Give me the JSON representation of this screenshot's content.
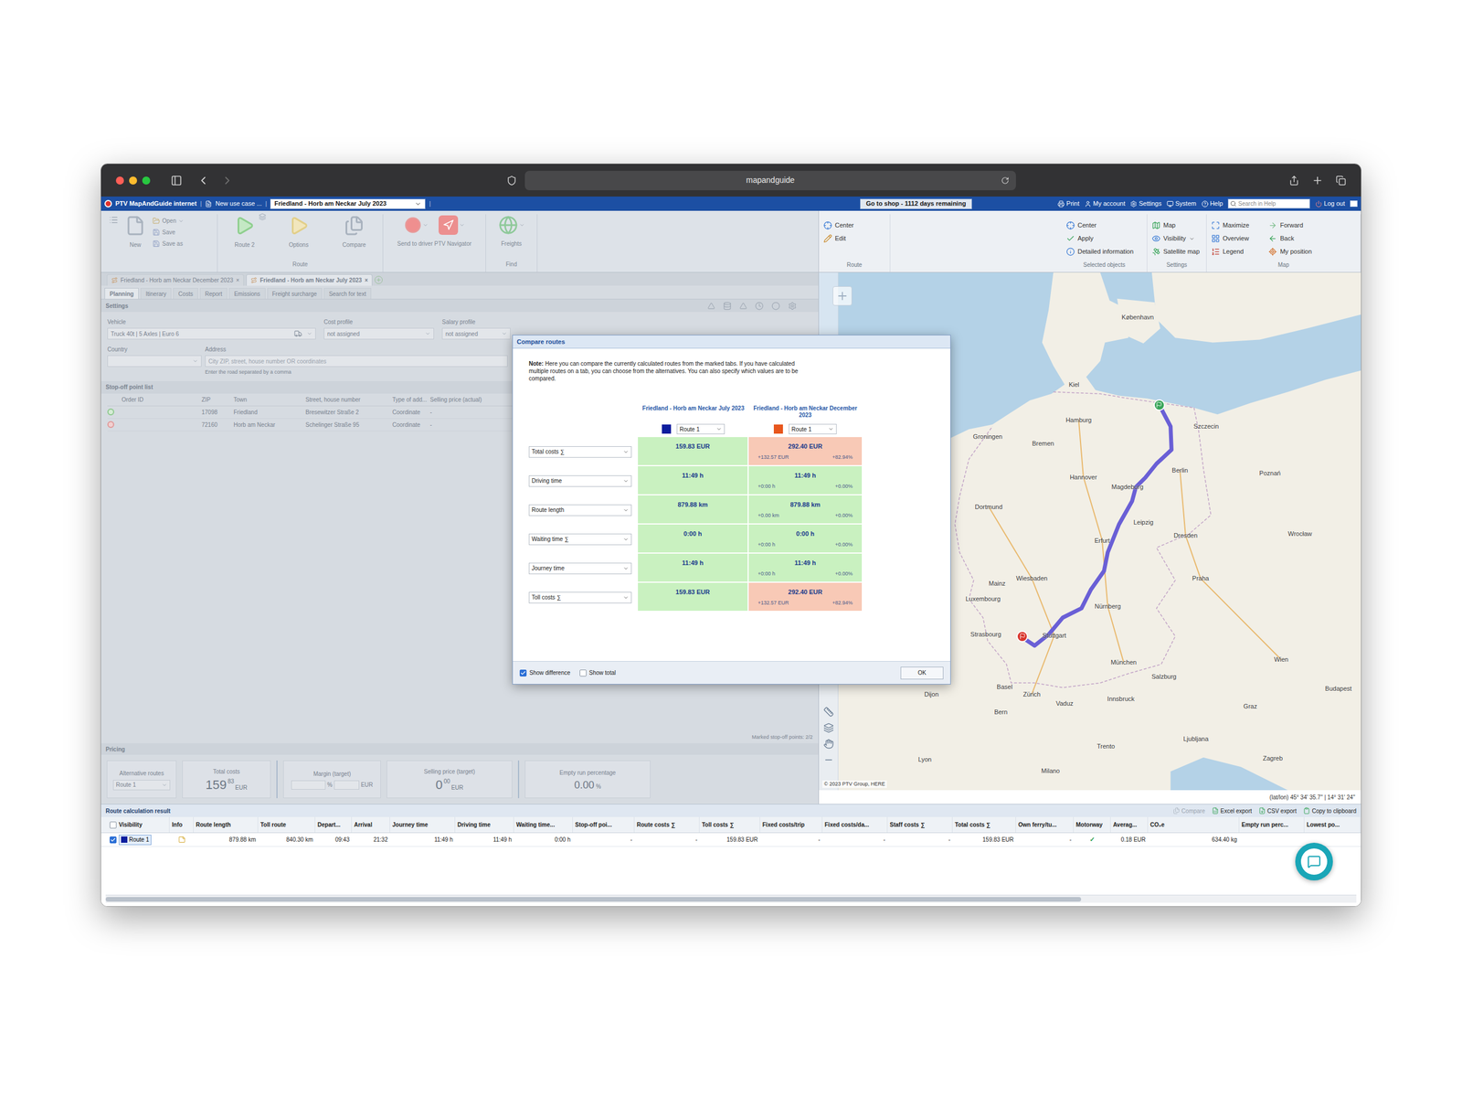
{
  "browser": {
    "url": "mapandguide"
  },
  "app_bar": {
    "product": "PTV MapAndGuide internet",
    "separator": "|",
    "use_case": "New use case ...",
    "tour_select": "Friedland - Horb am Neckar July 2023",
    "shop_button": "Go to shop - 1112 days remaining",
    "menu": [
      "Print",
      "My account",
      "Settings",
      "System",
      "Help"
    ],
    "search_placeholder": "Search in Help",
    "logout": "Log out"
  },
  "ribbon_left": {
    "new": "New",
    "open": "Open",
    "save": "Save",
    "save_as": "Save as",
    "route": "Route 2",
    "options": "Options",
    "compare": "Compare",
    "send": "Send to driver PTV Navigator",
    "freights": "Freights",
    "group_route": "Route",
    "group_find": "Find"
  },
  "ribbon_right": {
    "groups": [
      {
        "label": "Route",
        "items": [
          {
            "label": "Center",
            "dropdown": false
          },
          {
            "label": "Edit",
            "dropdown": false
          }
        ]
      },
      {
        "label": "Selected objects",
        "items": [
          {
            "label": "Center",
            "dropdown": false
          },
          {
            "label": "Apply",
            "dropdown": false
          },
          {
            "label": "Detailed information",
            "dropdown": false
          }
        ]
      },
      {
        "label": "Settings",
        "items": [
          {
            "label": "Map",
            "dropdown": false
          },
          {
            "label": "Visibility",
            "dropdown": true
          },
          {
            "label": "Satellite map",
            "dropdown": false
          }
        ]
      },
      {
        "label": "Map",
        "items": [
          {
            "label": "Maximize",
            "dropdown": false
          },
          {
            "label": "Overview",
            "dropdown": false
          },
          {
            "label": "Legend",
            "dropdown": false
          },
          {
            "label": "Forward",
            "dropdown": false
          },
          {
            "label": "Back",
            "dropdown": false
          },
          {
            "label": "My position",
            "dropdown": false
          }
        ]
      }
    ]
  },
  "left_pane": {
    "doc_tabs": [
      {
        "label": "Friedland - Horb am Neckar December 2023",
        "selected": false
      },
      {
        "label": "Friedland - Horb am Neckar July 2023",
        "selected": true
      }
    ],
    "tab_close": "×",
    "sub_tabs": [
      {
        "label": "Planning",
        "selected": true
      },
      {
        "label": "Itinerary",
        "selected": false
      },
      {
        "label": "Costs",
        "selected": false
      },
      {
        "label": "Report",
        "selected": false
      },
      {
        "label": "Emissions",
        "selected": false
      },
      {
        "label": "Freight surcharge",
        "selected": false
      },
      {
        "label": "Search for text",
        "selected": false
      }
    ],
    "settings": {
      "title": "Settings",
      "vehicle_label": "Vehicle",
      "vehicle": "Truck 40t | 5 Axles | Euro 6",
      "cost_profile_label": "Cost profile",
      "cost_profile": "not assigned",
      "salary_profile_label": "Salary profile",
      "salary_profile": "not assigned",
      "country_label": "Country",
      "address_label": "Address",
      "address_placeholder": "City ZIP, street, house number OR coordinates",
      "address_hint": "Enter the road separated by a comma"
    },
    "stop_list": {
      "title": "Stop-off point list",
      "columns": [
        "Order ID",
        "ZIP",
        "Town",
        "Street, house number",
        "Type of add...",
        "Selling price (actual)"
      ],
      "rows": [
        {
          "kind": "start",
          "cells": [
            "17098",
            "Friedland",
            "Bresewitzer Straße 2",
            "Coordinate",
            "-"
          ]
        },
        {
          "kind": "end",
          "cells": [
            "72160",
            "Horb am Neckar",
            "Schelinger Straße 95",
            "Coordinate",
            "-"
          ]
        }
      ]
    },
    "marked": "Marked stop-off points: 2/2",
    "pricing": {
      "title": "Pricing",
      "alternative_label": "Alternative routes",
      "alternative": "Route 1",
      "total_label": "Total costs",
      "total_int": "159",
      "total_frac": "83",
      "total_unit": "EUR",
      "margin_label": "Margin (target)",
      "margin_pct_unit": "%",
      "margin_eur_unit": "EUR",
      "selling_label": "Selling price (target)",
      "selling_int": "0",
      "selling_frac": "00",
      "selling_unit": "EUR",
      "empty_label": "Empty run percentage",
      "empty_value": "0.00",
      "empty_unit": "%"
    }
  },
  "map": {
    "cities": [
      "København",
      "Kiel",
      "Hamburg",
      "Szczecin",
      "Bremen",
      "Groningen",
      "Berlin",
      "Poznań",
      "Hannover",
      "Magdeburg",
      "Dortmund",
      "Leipzig",
      "Dresden",
      "Wrocław",
      "Erfurt",
      "Praha",
      "Wiesbaden",
      "Mainz",
      "Luxembourg",
      "Nürnberg",
      "Stuttgart",
      "Strasbourg",
      "München",
      "Wien",
      "Salzburg",
      "Basel",
      "Zürich",
      "Innsbruck",
      "Vaduz",
      "Budapest",
      "Bern",
      "Graz",
      "Ljubljana",
      "Trento",
      "Zagreb",
      "Milano",
      "Dijon",
      "Lyon"
    ],
    "copyright": "© 2023 PTV Group, HERE",
    "coordinates": "(lat/lon) 45° 34' 35.7'' | 14° 31' 24''"
  },
  "compare": {
    "title": "Compare routes",
    "note_label": "Note:",
    "note": "Here you can compare the currently calculated routes from the marked tabs. If you have calculated multiple routes on a tab, you can choose from the alternatives. You can also specify which values are to be compared.",
    "columns": [
      {
        "title": "Friedland - Horb am Neckar July 2023",
        "color": "#0b1d9e",
        "route": "Route 1"
      },
      {
        "title": "Friedland - Horb am Neckar December 2023",
        "color": "#e8561c",
        "route": "Route 1"
      }
    ],
    "rows": [
      {
        "metric": "Total costs ∑",
        "values": [
          "159.83 EUR",
          "292.40 EUR"
        ],
        "diff": "+132.57 EUR",
        "diff_pct": "+82.94%",
        "increased": true
      },
      {
        "metric": "Driving time",
        "values": [
          "11:49 h",
          "11:49 h"
        ],
        "diff": "+0:00 h",
        "diff_pct": "+0.00%",
        "increased": false
      },
      {
        "metric": "Route length",
        "values": [
          "879.88 km",
          "879.88 km"
        ],
        "diff": "+0.00 km",
        "diff_pct": "+0.00%",
        "increased": false
      },
      {
        "metric": "Waiting time ∑",
        "values": [
          "0:00 h",
          "0:00 h"
        ],
        "diff": "+0:00 h",
        "diff_pct": "+0.00%",
        "increased": false
      },
      {
        "metric": "Journey time",
        "values": [
          "11:49 h",
          "11:49 h"
        ],
        "diff": "+0:00 h",
        "diff_pct": "+0.00%",
        "increased": false
      },
      {
        "metric": "Toll costs ∑",
        "values": [
          "159.83 EUR",
          "292.40 EUR"
        ],
        "diff": "+132.57 EUR",
        "diff_pct": "+82.94%",
        "increased": true
      }
    ],
    "show_difference": {
      "label": "Show difference",
      "checked": true
    },
    "show_total": {
      "label": "Show total",
      "checked": false
    },
    "ok": "OK"
  },
  "results": {
    "title": "Route calculation result",
    "actions": [
      {
        "label": "Compare",
        "disabled": true
      },
      {
        "label": "Excel export",
        "disabled": false
      },
      {
        "label": "CSV export",
        "disabled": false
      },
      {
        "label": "Copy to clipboard",
        "disabled": false
      }
    ],
    "header_checked": false,
    "columns": [
      "Visibility",
      "Info",
      "Route length",
      "Toll route",
      "Depart...",
      "Arrival",
      "Journey time",
      "Driving time",
      "Waiting time...",
      "Stop-off poi...",
      "Route costs ∑",
      "Toll costs ∑",
      "Fixed costs/trip",
      "Fixed costs/da...",
      "Staff costs ∑",
      "Total costs ∑",
      "Own ferry/tu...",
      "Motorway",
      "Averag...",
      "CO₂e",
      "Empty run perc...",
      "Lowest po..."
    ],
    "rows": [
      {
        "checked": true,
        "selected": true,
        "route": "Route 1",
        "color": "#0b1d9e",
        "cells": [
          "879.88 km",
          "840.30 km",
          "09:43",
          "21:32",
          "11:49 h",
          "11:49 h",
          "0:00 h",
          "-",
          "-",
          "159.83 EUR",
          "-",
          "-",
          "-",
          "159.83 EUR",
          "-",
          "✓",
          "0.18 EUR",
          "634.40 kg"
        ]
      }
    ],
    "scrollbar": {
      "level": 0.78
    }
  }
}
